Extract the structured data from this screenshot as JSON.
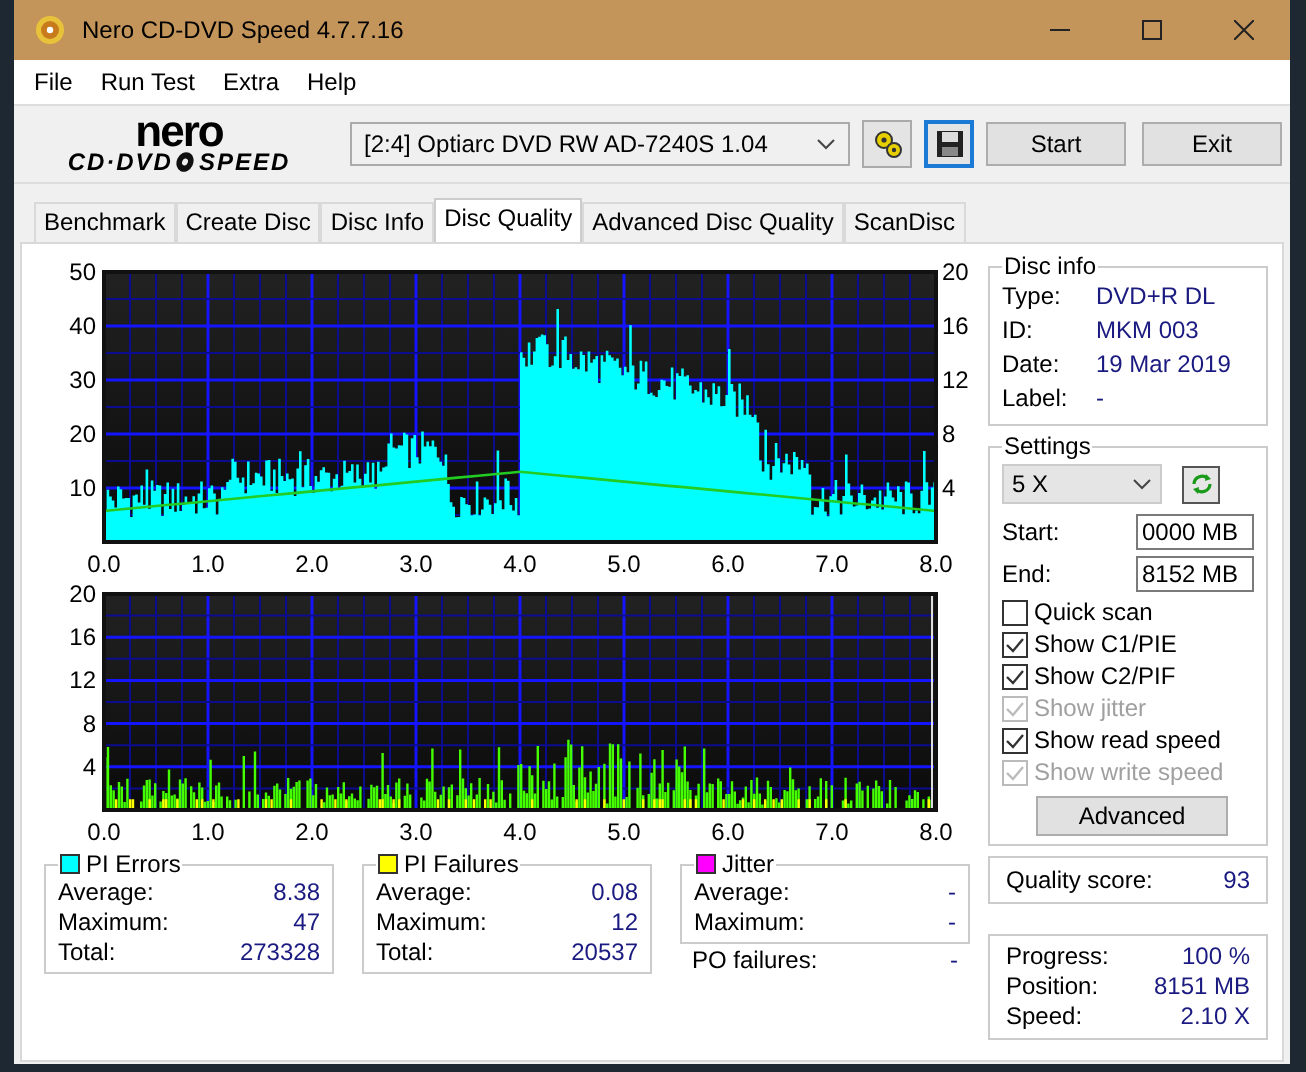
{
  "window": {
    "title": "Nero CD-DVD Speed 4.7.7.16"
  },
  "menu": [
    "File",
    "Run Test",
    "Extra",
    "Help"
  ],
  "logo": {
    "brand": "nero",
    "line_left": "CD·DVD",
    "line_right": "SPEED"
  },
  "drive": {
    "value": "[2:4]   Optiarc DVD RW AD-7240S 1.04"
  },
  "buttons": [
    "Start",
    "Exit"
  ],
  "tabs": [
    {
      "label": "Benchmark",
      "selected": false
    },
    {
      "label": "Create Disc",
      "selected": false
    },
    {
      "label": "Disc Info",
      "selected": false
    },
    {
      "label": "Disc Quality",
      "selected": true
    },
    {
      "label": "Advanced Disc Quality",
      "selected": false
    },
    {
      "label": "ScanDisc",
      "selected": false
    }
  ],
  "charts": [
    {
      "kind": "errors",
      "y_ticks": [
        "50",
        "40",
        "30",
        "20",
        "10"
      ],
      "y2_ticks": [
        "20",
        "16",
        "12",
        "8",
        "4"
      ],
      "x_ticks": [
        "0.0",
        "1.0",
        "2.0",
        "3.0",
        "4.0",
        "5.0",
        "6.0",
        "7.0",
        "8.0"
      ]
    },
    {
      "kind": "failures",
      "y_ticks": [
        "20",
        "16",
        "12",
        "8",
        "4"
      ],
      "x_ticks": [
        "0.0",
        "1.0",
        "2.0",
        "3.0",
        "4.0",
        "5.0",
        "6.0",
        "7.0",
        "8.0"
      ]
    }
  ],
  "disc_info": {
    "title": "Disc info",
    "rows": [
      {
        "label": "Type:",
        "value": "DVD+R DL"
      },
      {
        "label": "ID:",
        "value": "MKM 003"
      },
      {
        "label": "Date:",
        "value": "19 Mar 2019"
      },
      {
        "label": "Label:",
        "value": "-"
      }
    ]
  },
  "settings": {
    "title": "Settings",
    "speed": "5 X",
    "start_label": "Start:",
    "start": "0000 MB",
    "end_label": "End:",
    "end": "8152 MB",
    "options": [
      {
        "label": "Quick scan",
        "checked": false,
        "disabled": false
      },
      {
        "label": "Show C1/PIE",
        "checked": true,
        "disabled": false
      },
      {
        "label": "Show C2/PIF",
        "checked": true,
        "disabled": false
      },
      {
        "label": "Show jitter",
        "checked": true,
        "disabled": true
      },
      {
        "label": "Show read speed",
        "checked": true,
        "disabled": false
      },
      {
        "label": "Show write speed",
        "checked": true,
        "disabled": true
      }
    ],
    "advanced": "Advanced"
  },
  "quality": {
    "label": "Quality score:",
    "value": "93"
  },
  "stats": [
    {
      "title": "PI Errors",
      "color": "#00ffff",
      "rows": [
        {
          "label": "Average:",
          "value": "8.38"
        },
        {
          "label": "Maximum:",
          "value": "47"
        },
        {
          "label": "Total:",
          "value": "273328"
        }
      ]
    },
    {
      "title": "PI Failures",
      "color": "#ffff00",
      "rows": [
        {
          "label": "Average:",
          "value": "0.08"
        },
        {
          "label": "Maximum:",
          "value": "12"
        },
        {
          "label": "Total:",
          "value": "20537"
        }
      ]
    },
    {
      "title": "Jitter",
      "color": "#ff00ff",
      "rows": [
        {
          "label": "Average:",
          "value": "-"
        },
        {
          "label": "Maximum:",
          "value": "-"
        }
      ]
    }
  ],
  "po_failures": {
    "label": "PO failures:",
    "value": "-"
  },
  "progress": [
    {
      "label": "Progress:",
      "value": "100 %"
    },
    {
      "label": "Position:",
      "value": "8151 MB"
    },
    {
      "label": "Speed:",
      "value": "2.10 X"
    }
  ]
}
